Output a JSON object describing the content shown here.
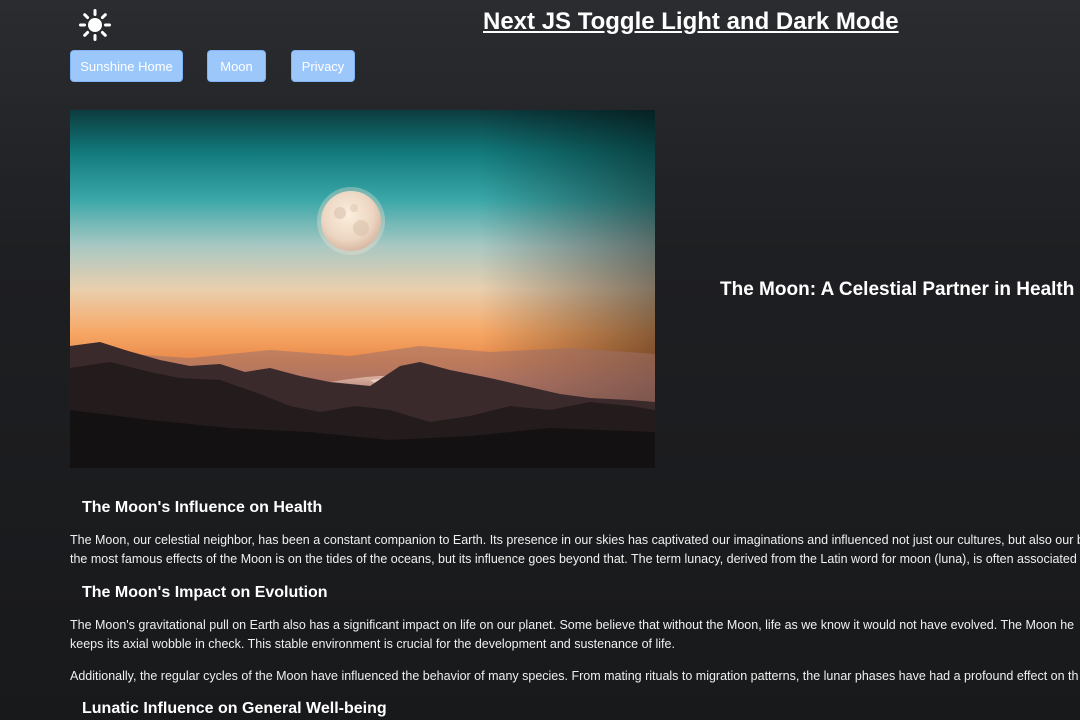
{
  "header": {
    "theme_toggle_icon": "sun-icon",
    "title": "Next JS Toggle Light and Dark Mode"
  },
  "nav": {
    "buttons": [
      {
        "label": "Sunshine Home"
      },
      {
        "label": "Moon"
      },
      {
        "label": "Privacy"
      }
    ],
    "button_color": "#9cc7fb"
  },
  "hero": {
    "image": "moon-over-mountains-image",
    "title": "The Moon: A Celestial Partner in Health a"
  },
  "sections": [
    {
      "heading": "The Moon's Influence on Health",
      "paragraphs": [
        {
          "lines": [
            "The Moon, our celestial neighbor, has been a constant companion to Earth. Its presence in our skies has captivated our imaginations and influenced not just our cultures, but also our b",
            "the most famous effects of the Moon is on the tides of the oceans, but its influence goes beyond that. The term lunacy, derived from the Latin word for moon (luna), is often associated"
          ]
        }
      ]
    },
    {
      "heading": "The Moon's Impact on Evolution",
      "paragraphs": [
        {
          "lines": [
            "The Moon's gravitational pull on Earth also has a significant impact on life on our planet. Some believe that without the Moon, life as we know it would not have evolved. The Moon he",
            "keeps its axial wobble in check. This stable environment is crucial for the development and sustenance of life."
          ]
        },
        {
          "lines": [
            "Additionally, the regular cycles of the Moon have influenced the behavior of many species. From mating rituals to migration patterns, the lunar phases have had a profound effect on th"
          ]
        }
      ]
    },
    {
      "heading": "Lunatic Influence on General Well-being",
      "paragraphs": []
    }
  ],
  "colors": {
    "background": "#1e1f22",
    "text": "#f2f2f2"
  }
}
